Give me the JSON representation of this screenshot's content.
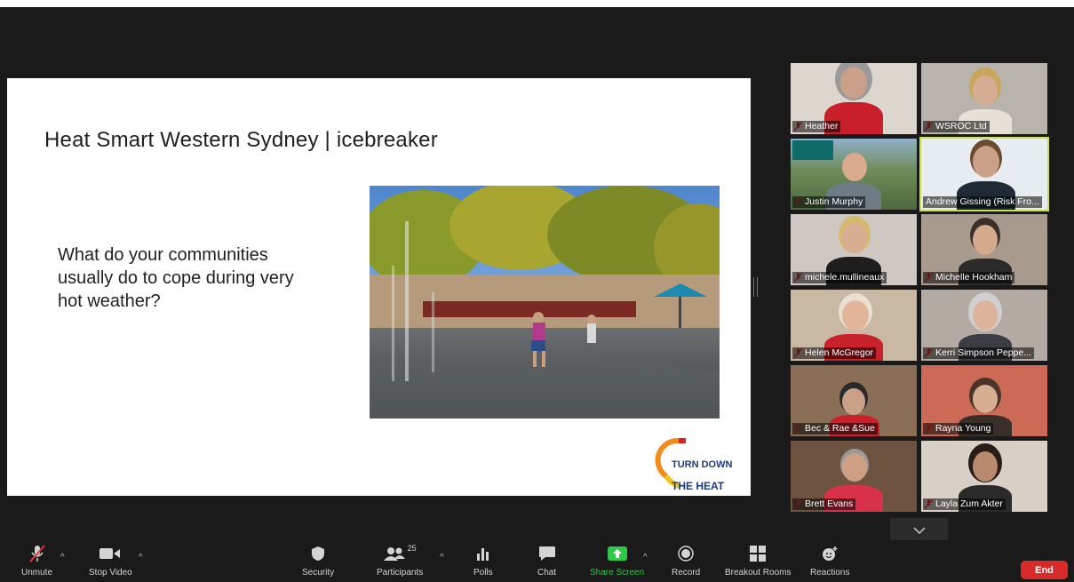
{
  "slide": {
    "title": "Heat Smart Western Sydney | icebreaker",
    "body": "What do your communities\nusually do to cope during very\nhot weather?",
    "logo_line1": "TURN DOWN",
    "logo_line2": "THE HEAT"
  },
  "participants": [
    {
      "name": "Heather",
      "muted": true
    },
    {
      "name": "WSROC Ltd",
      "muted": true
    },
    {
      "name": "Justin Murphy",
      "muted": true
    },
    {
      "name": "Andrew Gissing (Risk Fro...",
      "muted": false,
      "active": true
    },
    {
      "name": "michele.mullineaux",
      "muted": true
    },
    {
      "name": "Michelle Hookham",
      "muted": true
    },
    {
      "name": "Helen McGregor",
      "muted": true
    },
    {
      "name": "Kerri Simpson Peppe...",
      "muted": true
    },
    {
      "name": "Bec  & Rae &Sue",
      "muted": true
    },
    {
      "name": "Rayna Young",
      "muted": true
    },
    {
      "name": "Brett Evans",
      "muted": true
    },
    {
      "name": "Layla Zum Akter",
      "muted": true
    }
  ],
  "toolbar": {
    "unmute": "Unmute",
    "stop_video": "Stop Video",
    "security": "Security",
    "participants": "Participants",
    "participant_count": "25",
    "polls": "Polls",
    "chat": "Chat",
    "share_screen": "Share Screen",
    "record": "Record",
    "breakout_rooms": "Breakout Rooms",
    "reactions": "Reactions",
    "end": "End"
  },
  "colors": {
    "end_button": "#d92a2a",
    "share_green": "#2fc94a",
    "active_speaker": "#c7e04b"
  }
}
